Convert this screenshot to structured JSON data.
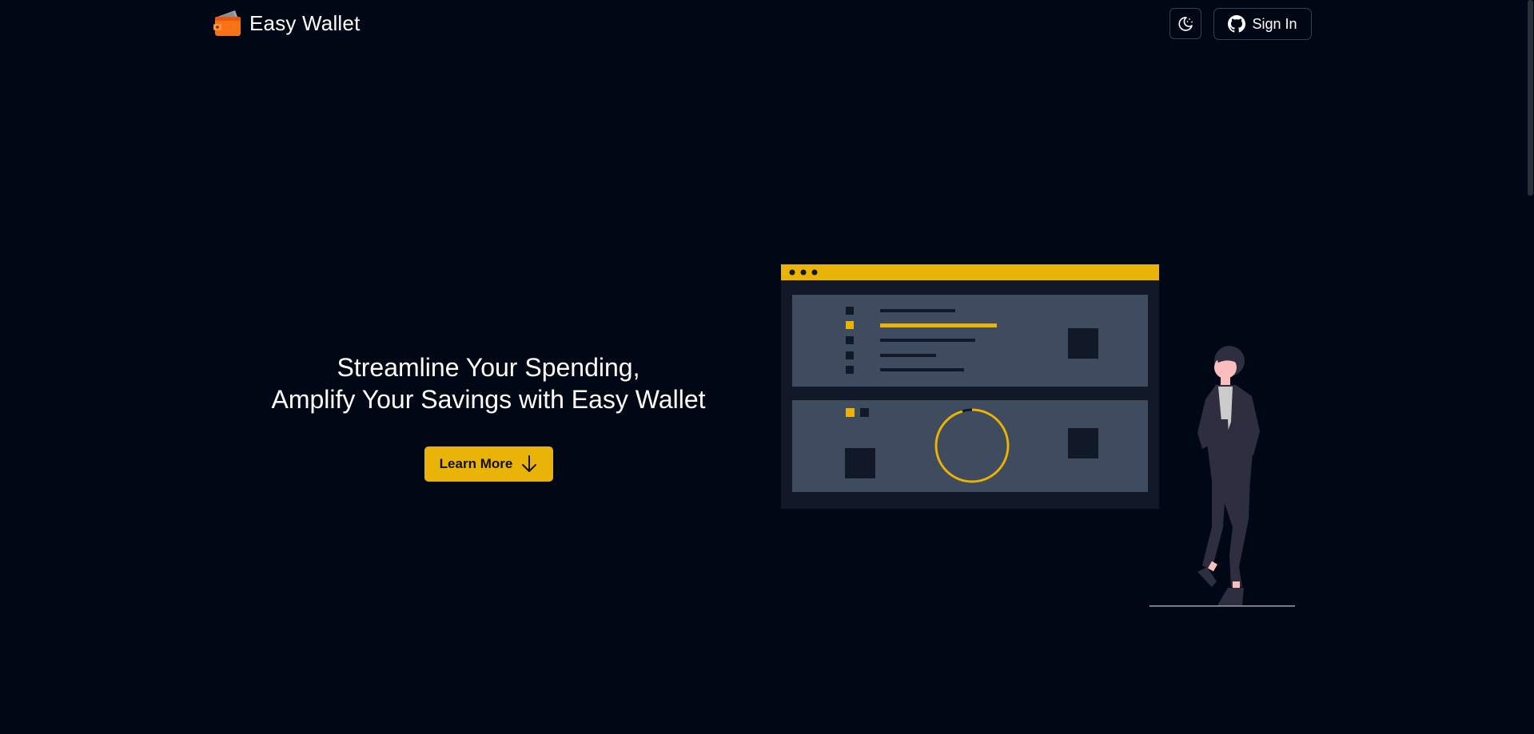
{
  "brand": {
    "name": "Easy Wallet",
    "logo_icon": "wallet-icon"
  },
  "header": {
    "theme_toggle_icon": "moon-sun-icon",
    "signin_label": "Sign In",
    "signin_icon": "github-icon"
  },
  "hero": {
    "title_line1": "Streamline Your Spending,",
    "title_line2": "Amplify Your Savings with Easy Wallet",
    "cta_label": "Learn More",
    "cta_icon": "arrow-down-icon"
  },
  "colors": {
    "background": "#010815",
    "accent": "#eab308",
    "panel": "#3f4b5f",
    "panel_frame": "#121826"
  }
}
